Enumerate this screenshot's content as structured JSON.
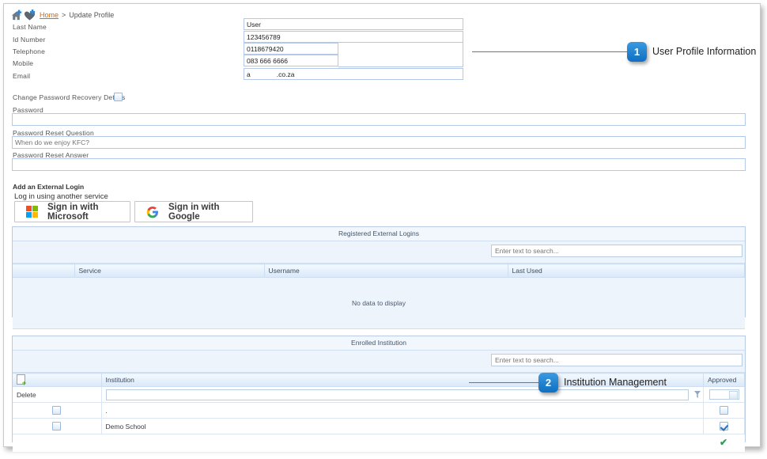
{
  "breadcrumb": {
    "home_icon": "home-add-icon",
    "favorite_icon": "heart-add-icon",
    "home_link": "Home",
    "separator": ">",
    "current": "Update Profile"
  },
  "profile": {
    "fields": [
      {
        "label": "Last Name",
        "value": "User",
        "placeholder": ""
      },
      {
        "label": "Id Number",
        "value": "123456789",
        "placeholder": ""
      },
      {
        "label": "Telephone",
        "value": "0118679420",
        "placeholder": ""
      },
      {
        "label": "Mobile",
        "value": "083 666 6666",
        "placeholder": ""
      },
      {
        "label": "Email",
        "value": "a              .co.za",
        "placeholder": ""
      }
    ]
  },
  "password_recovery": {
    "toggle_label": "Change Password Recovery Details",
    "toggle_checked": false,
    "password_label": "Password",
    "password_value": "",
    "question_label": "Password Reset Question",
    "question_placeholder": "When do we enjoy KFC?",
    "question_value": "",
    "answer_label": "Password Reset Answer",
    "answer_value": ""
  },
  "external_login": {
    "title": "Add an External Login",
    "subtitle": "Log in using another service",
    "buttons": [
      {
        "label": "Sign in with Microsoft",
        "icon": "microsoft-logo-icon"
      },
      {
        "label": "Sign in with Google",
        "icon": "google-logo-icon"
      }
    ]
  },
  "registered_logins_grid": {
    "title": "Registered External Logins",
    "search_placeholder": "Enter text to search...",
    "search_value": "",
    "columns": [
      "",
      "Service",
      "Username",
      "Last Used"
    ],
    "empty_message": "No data to display"
  },
  "enrolled_institution_grid": {
    "title": "Enrolled Institution",
    "search_placeholder": "Enter text to search...",
    "search_value": "",
    "columns": [
      "",
      "Institution",
      "Approved"
    ],
    "header_icon": "new-row-icon",
    "filter_row": {
      "label": "Delete",
      "institution_filter_value": "",
      "filter_icon": "funnel-icon",
      "approved_filter_value": ""
    },
    "rows": [
      {
        "delete_checked": false,
        "institution": ".",
        "approved_checked": false
      },
      {
        "delete_checked": false,
        "institution": "Demo School",
        "approved_checked": true
      }
    ],
    "confirm_icon": "green-check-icon"
  },
  "annotations": [
    {
      "number": "1",
      "text": "User Profile Information"
    },
    {
      "number": "2",
      "text": "Institution Management"
    }
  ],
  "colors": {
    "accent": "#2f86d4",
    "badge": "#0f6fc2",
    "link": "#d2690a",
    "grid_bg": "#eef4fc",
    "field_border": "#b4c9e8",
    "green": "#2f9e52"
  }
}
